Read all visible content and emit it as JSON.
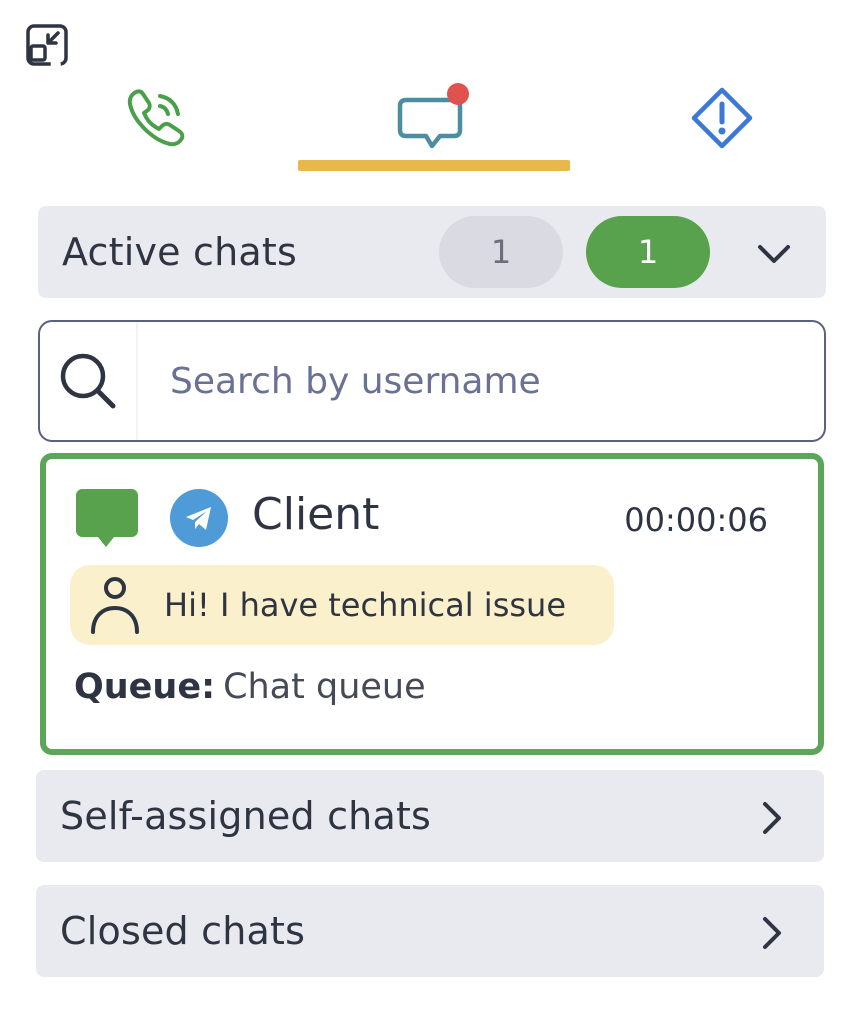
{
  "colors": {
    "accent_tab": "#e8b94a",
    "phone_green": "#4aa04a",
    "chat_teal": "#4a8ea0",
    "alert_blue": "#3b78d8",
    "notification_red": "#e0524d",
    "active_green": "#5ca55a",
    "telegram_blue": "#4f9bd8",
    "message_bg": "#fbf0cc"
  },
  "toolbar": {
    "minimize_icon": "minimize-icon"
  },
  "tabs": [
    {
      "icon": "phone-icon",
      "active": false
    },
    {
      "icon": "chat-icon",
      "active": true,
      "has_notification": true
    },
    {
      "icon": "alert-icon",
      "active": false
    }
  ],
  "active_chats": {
    "title": "Active chats",
    "count_grey": "1",
    "count_green": "1",
    "expanded": true
  },
  "search": {
    "placeholder": "Search by username",
    "value": ""
  },
  "chat_card": {
    "client": "Client",
    "timer": "00:00:06",
    "channel_icon": "telegram-icon",
    "message": "Hi! I have technical issue",
    "queue_label": "Queue:",
    "queue_value": "Chat queue"
  },
  "self_assigned": {
    "title": "Self-assigned chats"
  },
  "closed": {
    "title": "Closed chats"
  }
}
